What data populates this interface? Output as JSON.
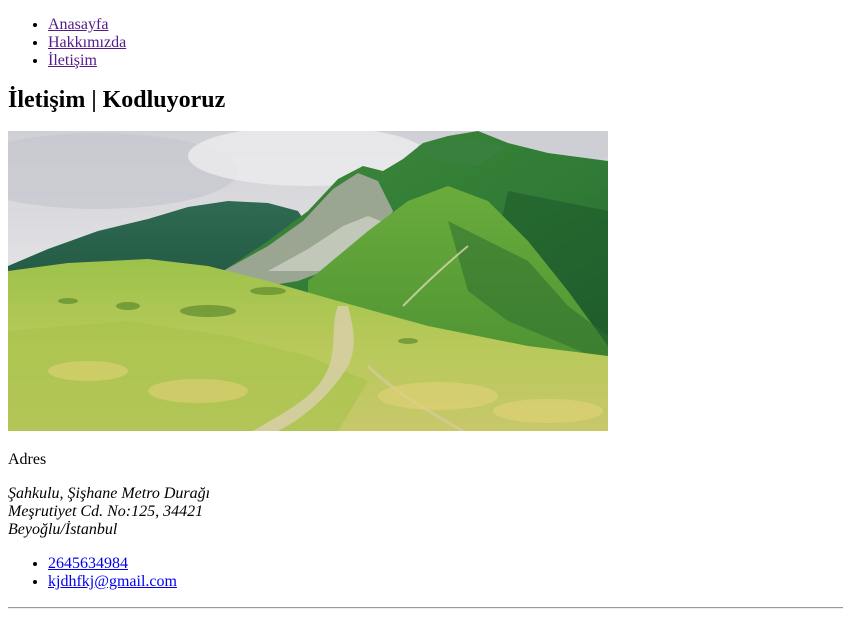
{
  "nav": {
    "items": [
      {
        "label": "Anasayfa"
      },
      {
        "label": "Hakkımızda"
      },
      {
        "label": "İletişim"
      }
    ]
  },
  "page": {
    "title": "İletişim | Kodluyoruz"
  },
  "address": {
    "label": "Adres",
    "lines": [
      "Şahkulu, Şişhane Metro Durağı",
      "Meşrutiyet Cd. No:125, 34421",
      "Beyoğlu/İstanbul"
    ]
  },
  "contact": {
    "phone": "2645634984",
    "email": "kjdhfkj@gmail.com"
  },
  "image": {
    "subject": "mountain-meadow-landscape"
  }
}
